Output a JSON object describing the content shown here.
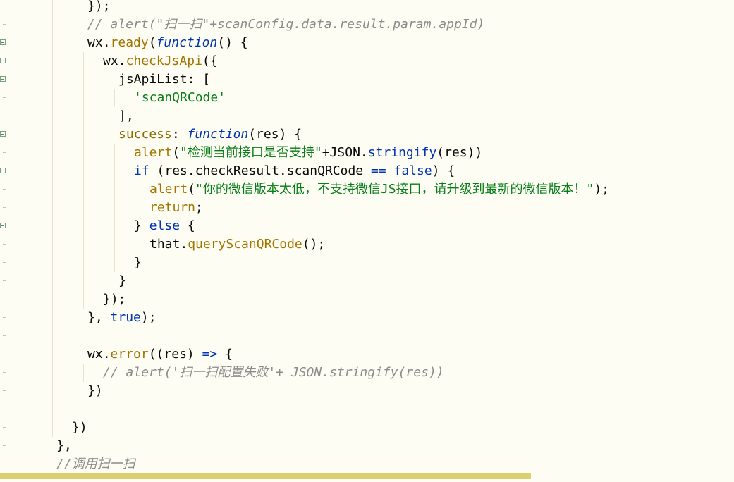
{
  "editor": {
    "lines": [
      {
        "indent": 5,
        "fold": false,
        "tokens": [
          [
            "}",
            "id"
          ],
          [
            ");",
            "id"
          ]
        ]
      },
      {
        "indent": 5,
        "fold": false,
        "tokens": [
          [
            "// alert(\"扫一扫\"+scanConfig.data.result.param.appId)",
            "cm"
          ]
        ]
      },
      {
        "indent": 5,
        "fold": true,
        "tokens": [
          [
            "wx",
            "id"
          ],
          [
            ".",
            "id"
          ],
          [
            "ready",
            "fn"
          ],
          [
            "(",
            "id"
          ],
          [
            "function",
            "it"
          ],
          [
            "() {",
            "id"
          ]
        ]
      },
      {
        "indent": 6,
        "fold": true,
        "tokens": [
          [
            "wx",
            "id"
          ],
          [
            ".",
            "id"
          ],
          [
            "checkJsApi",
            "fn"
          ],
          [
            "({",
            "id"
          ]
        ]
      },
      {
        "indent": 7,
        "fold": true,
        "tokens": [
          [
            "jsApiList",
            "id"
          ],
          [
            ": [",
            "id"
          ]
        ]
      },
      {
        "indent": 8,
        "fold": false,
        "tokens": [
          [
            "'scanQRCode'",
            "str"
          ]
        ]
      },
      {
        "indent": 7,
        "fold": false,
        "tokens": [
          [
            "],",
            "id"
          ]
        ]
      },
      {
        "indent": 7,
        "fold": true,
        "tokens": [
          [
            "success",
            "prop"
          ],
          [
            ": ",
            "id"
          ],
          [
            "function",
            "it"
          ],
          [
            "(res) {",
            "id"
          ]
        ]
      },
      {
        "indent": 8,
        "fold": false,
        "tokens": [
          [
            "alert",
            "fn"
          ],
          [
            "(",
            "id"
          ],
          [
            "\"检测当前接口是否支持\"",
            "str"
          ],
          [
            "+JSON.",
            "id"
          ],
          [
            "stringify",
            "kw"
          ],
          [
            "(res))",
            "id"
          ]
        ]
      },
      {
        "indent": 8,
        "fold": true,
        "tokens": [
          [
            "if",
            "kw"
          ],
          [
            " (res.checkResult.scanQRCode ",
            "id"
          ],
          [
            "==",
            "kw"
          ],
          [
            " ",
            "id"
          ],
          [
            "false",
            "bool"
          ],
          [
            ") {",
            "id"
          ]
        ]
      },
      {
        "indent": 9,
        "fold": false,
        "tokens": [
          [
            "alert",
            "fn"
          ],
          [
            "(",
            "id"
          ],
          [
            "\"你的微信版本太低，不支持微信JS接口，请升级到最新的微信版本！\"",
            "str"
          ],
          [
            ");",
            "id"
          ]
        ]
      },
      {
        "indent": 9,
        "fold": false,
        "tokens": [
          [
            "return",
            "fn"
          ],
          [
            ";",
            "id"
          ]
        ]
      },
      {
        "indent": 8,
        "fold": true,
        "tokens": [
          [
            "} ",
            "id"
          ],
          [
            "else",
            "kw"
          ],
          [
            " {",
            "id"
          ]
        ]
      },
      {
        "indent": 9,
        "fold": false,
        "tokens": [
          [
            "that",
            "id"
          ],
          [
            ".",
            "id"
          ],
          [
            "queryScanQRCode",
            "fn"
          ],
          [
            "();",
            "id"
          ]
        ]
      },
      {
        "indent": 8,
        "fold": false,
        "tokens": [
          [
            "}",
            "id"
          ]
        ]
      },
      {
        "indent": 7,
        "fold": false,
        "tokens": [
          [
            "}",
            "id"
          ]
        ]
      },
      {
        "indent": 6,
        "fold": false,
        "tokens": [
          [
            "});",
            "id"
          ]
        ]
      },
      {
        "indent": 5,
        "fold": false,
        "tokens": [
          [
            "}, ",
            "id"
          ],
          [
            "true",
            "bool"
          ],
          [
            ");",
            "id"
          ]
        ]
      },
      {
        "indent": 5,
        "fold": false,
        "tokens": []
      },
      {
        "indent": 5,
        "fold": false,
        "tokens": [
          [
            "wx",
            "id"
          ],
          [
            ".",
            "id"
          ],
          [
            "error",
            "fn"
          ],
          [
            "((res) ",
            "id"
          ],
          [
            "=>",
            "kw"
          ],
          [
            " {",
            "id"
          ]
        ]
      },
      {
        "indent": 6,
        "fold": false,
        "tokens": [
          [
            "// alert('扫一扫配置失败'+ JSON.stringify(res))",
            "cm"
          ]
        ]
      },
      {
        "indent": 5,
        "fold": false,
        "tokens": [
          [
            "})",
            "id"
          ]
        ]
      },
      {
        "indent": 4,
        "fold": false,
        "tokens": []
      },
      {
        "indent": 4,
        "fold": false,
        "tokens": [
          [
            "})",
            "id"
          ]
        ]
      },
      {
        "indent": 3,
        "fold": false,
        "tokens": [
          [
            "},",
            "id"
          ]
        ]
      },
      {
        "indent": 3,
        "fold": false,
        "tokens": [
          [
            "//调用扫一扫",
            "cm"
          ]
        ]
      }
    ]
  },
  "colors": {
    "background": "#fdfdf3",
    "keyword": "#0033b3",
    "function_call": "#a27400",
    "string": "#067d17",
    "comment": "#8c8c8c",
    "scrollbar_thumb": "#dccf71"
  }
}
